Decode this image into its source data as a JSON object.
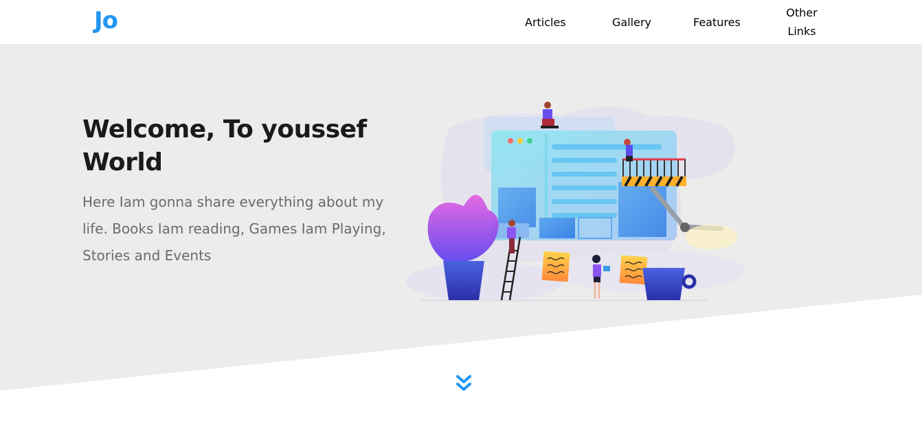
{
  "header": {
    "logo": "Jo",
    "nav": [
      {
        "label": "Articles"
      },
      {
        "label": "Gallery"
      },
      {
        "label": "Features"
      },
      {
        "label": "Other Links"
      }
    ]
  },
  "hero": {
    "title": "Welcome, To youssef World",
    "description": "Here Iam gonna share everything about my life. Books Iam reading, Games Iam Playing, Stories and Events"
  },
  "icons": {
    "scroll_down": "chevron-double-down-icon",
    "illustration": "team-building-website-illustration"
  },
  "colors": {
    "accent": "#2196f3",
    "hero_bg": "#ececec",
    "title": "#1a1a1a",
    "description": "#6a6a6a"
  }
}
